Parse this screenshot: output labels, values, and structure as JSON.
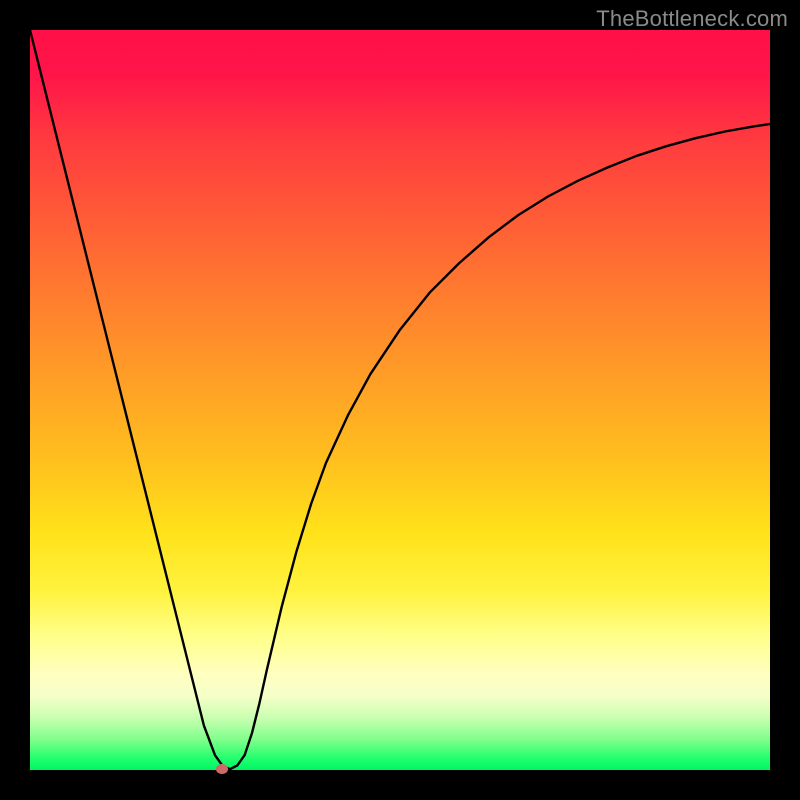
{
  "watermark": "TheBottleneck.com",
  "colors": {
    "frame": "#000000",
    "marker": "#cc6a6a",
    "curve": "#000000",
    "gradient_stops": [
      "#ff1048",
      "#ff3b3f",
      "#ff6a33",
      "#ff9828",
      "#ffbf1e",
      "#ffe21a",
      "#fff340",
      "#ffff8a",
      "#ffffc0",
      "#f5ffc8",
      "#c8ffb0",
      "#7cff8a",
      "#1fff6d",
      "#00f564"
    ]
  },
  "chart_data": {
    "type": "line",
    "title": "",
    "xlabel": "",
    "ylabel": "",
    "xlim": [
      0,
      100
    ],
    "ylim": [
      0,
      100
    ],
    "grid": false,
    "legend": false,
    "series": [
      {
        "name": "curve",
        "x": [
          0,
          2,
          4,
          6,
          8,
          10,
          12,
          14,
          16,
          18,
          20,
          22,
          23.5,
          25,
          26,
          27,
          28,
          29,
          30,
          31,
          32,
          34,
          36,
          38,
          40,
          43,
          46,
          50,
          54,
          58,
          62,
          66,
          70,
          74,
          78,
          82,
          86,
          90,
          94,
          98,
          100
        ],
        "y": [
          100,
          92,
          84,
          76,
          68,
          60,
          52,
          44,
          36,
          28,
          20,
          12,
          6,
          2,
          0.6,
          0.1,
          0.6,
          2,
          5,
          9,
          13.5,
          22,
          29.5,
          36,
          41.5,
          48,
          53.5,
          59.5,
          64.5,
          68.5,
          72,
          75,
          77.5,
          79.6,
          81.4,
          83,
          84.3,
          85.4,
          86.3,
          87,
          87.3
        ]
      }
    ],
    "marker": {
      "x": 26,
      "y": 0.1
    },
    "annotations": []
  }
}
